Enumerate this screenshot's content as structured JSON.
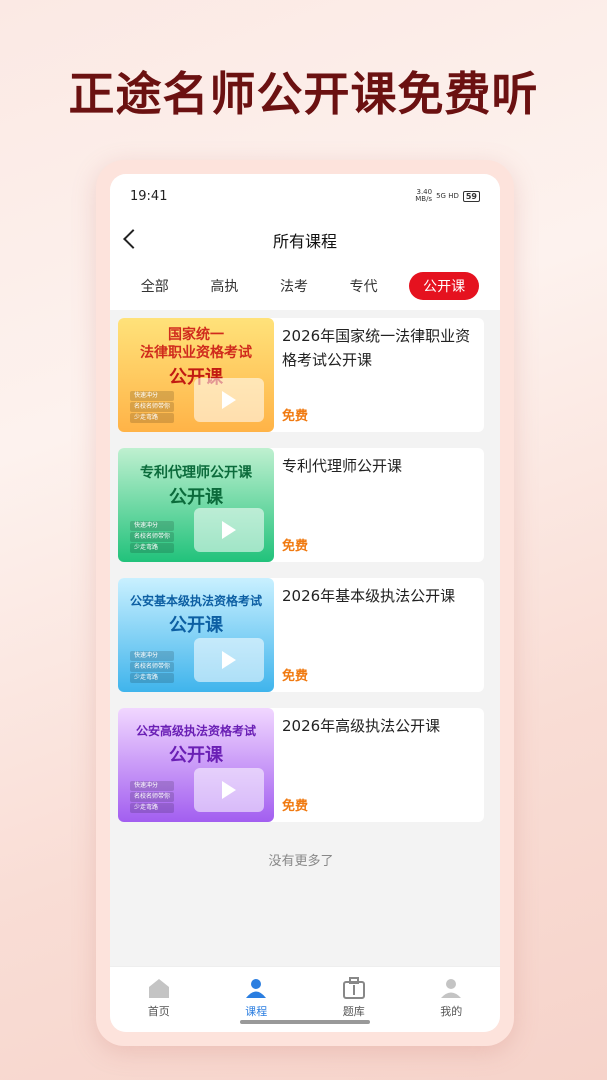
{
  "headline": "正途名师公开课免费听",
  "status": {
    "time": "19:41",
    "net_speed": "3.40\nMB/s",
    "signal": "5G HD",
    "battery": "59"
  },
  "nav": {
    "title": "所有课程"
  },
  "tabs": [
    {
      "label": "全部"
    },
    {
      "label": "高执"
    },
    {
      "label": "法考"
    },
    {
      "label": "专代"
    },
    {
      "label": "公开课",
      "active": true
    }
  ],
  "courses": [
    {
      "thumb_line1": "国家统一\n法律职业资格考试",
      "thumb_line2": "公开课",
      "title": "2026年国家统一法律职业资格考试公开课",
      "price": "免费",
      "tags": [
        "快速冲分",
        "名校名师带你",
        "少走弯路"
      ]
    },
    {
      "thumb_line1": "专利代理师公开课",
      "thumb_line2": "公开课",
      "title": "专利代理师公开课",
      "price": "免费",
      "tags": [
        "快速冲分",
        "名校名师带你",
        "少走弯路"
      ]
    },
    {
      "thumb_line1": "公安基本级执法资格考试",
      "thumb_line2": "公开课",
      "title": "2026年基本级执法公开课",
      "price": "免费",
      "tags": [
        "快速冲分",
        "名校名师带你",
        "少走弯路"
      ]
    },
    {
      "thumb_line1": "公安高级执法资格考试",
      "thumb_line2": "公开课",
      "title": "2026年高级执法公开课",
      "price": "免费",
      "tags": [
        "快速冲分",
        "名校名师带你",
        "少走弯路"
      ]
    }
  ],
  "no_more": "没有更多了",
  "bottom_nav": [
    {
      "label": "首页",
      "icon": "home-icon"
    },
    {
      "label": "课程",
      "icon": "course-icon",
      "active": true
    },
    {
      "label": "题库",
      "icon": "question-bank-icon"
    },
    {
      "label": "我的",
      "icon": "profile-icon"
    }
  ],
  "colors": {
    "accent": "#e5121f",
    "price": "#f07a11",
    "active_nav": "#2b7ee0",
    "headline": "#6b1111"
  }
}
